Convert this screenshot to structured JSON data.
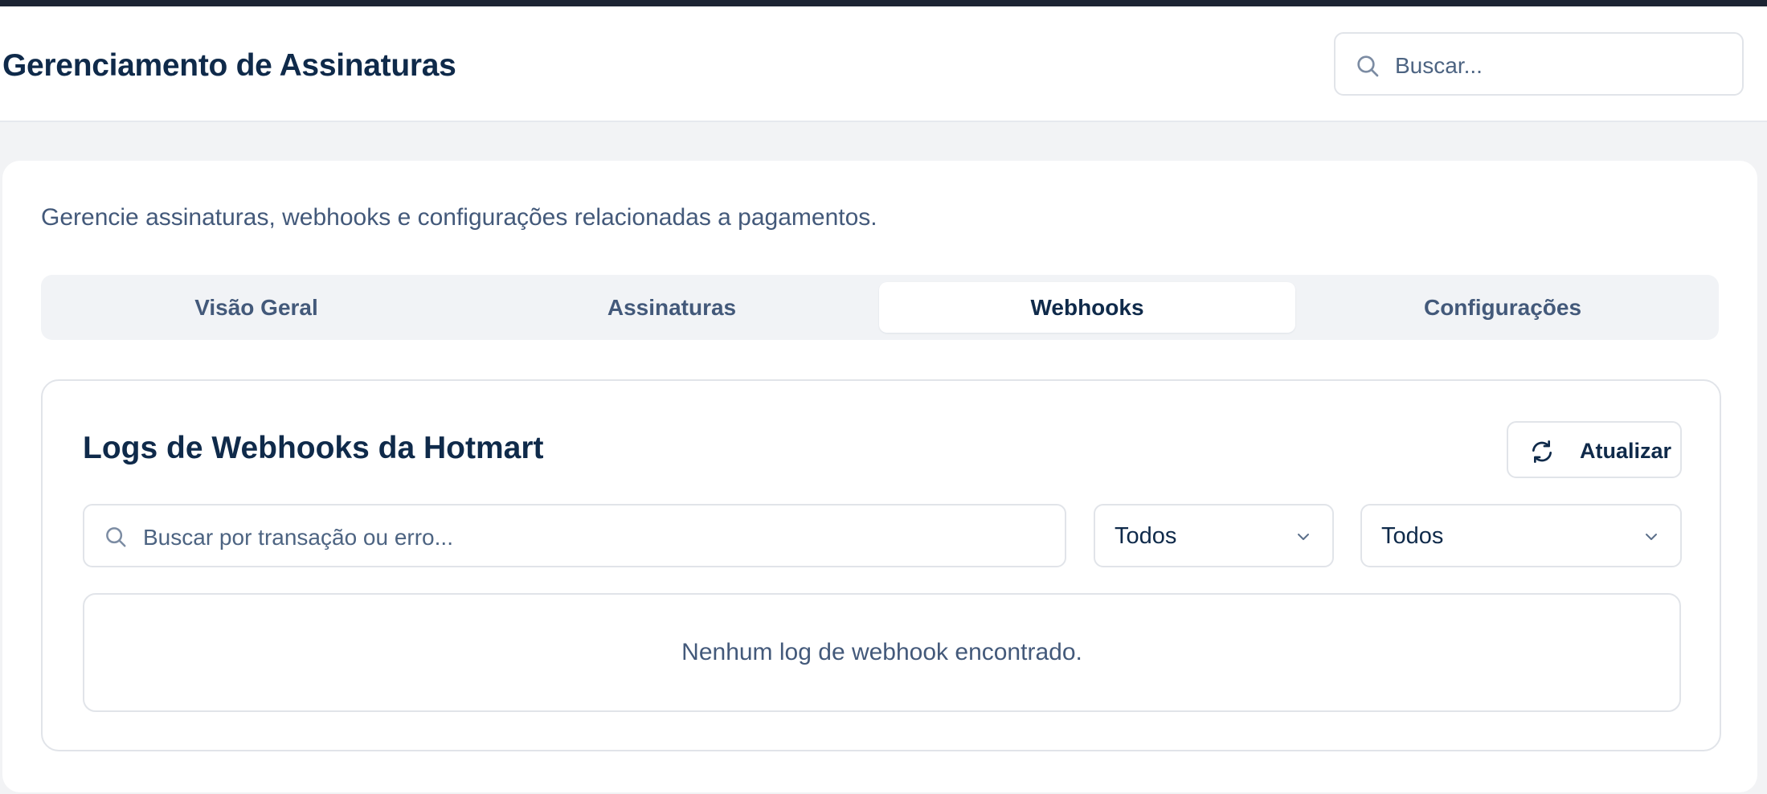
{
  "header": {
    "title": "Gerenciamento de Assinaturas",
    "search_placeholder": "Buscar..."
  },
  "main": {
    "subtitle": "Gerencie assinaturas, webhooks e configurações relacionadas a pagamentos.",
    "tabs": [
      {
        "label": "Visão Geral",
        "active": false
      },
      {
        "label": "Assinaturas",
        "active": false
      },
      {
        "label": "Webhooks",
        "active": true
      },
      {
        "label": "Configurações",
        "active": false
      }
    ]
  },
  "webhooks": {
    "title": "Logs de Webhooks da Hotmart",
    "refresh_label": "Atualizar",
    "search_placeholder": "Buscar por transação ou erro...",
    "filter_1_value": "Todos",
    "filter_2_value": "Todos",
    "empty_message": "Nenhum log de webhook encontrado."
  },
  "icons": {
    "header_search": "search-icon",
    "filter_search": "search-icon",
    "refresh": "refresh-icon",
    "select_chevron": "chevron-down-icon"
  },
  "colors": {
    "heading": "#0f2a4a",
    "muted_text": "#43597a",
    "border": "#e1e4e9",
    "page_background": "#f2f3f5",
    "top_strip": "#1c2433"
  }
}
